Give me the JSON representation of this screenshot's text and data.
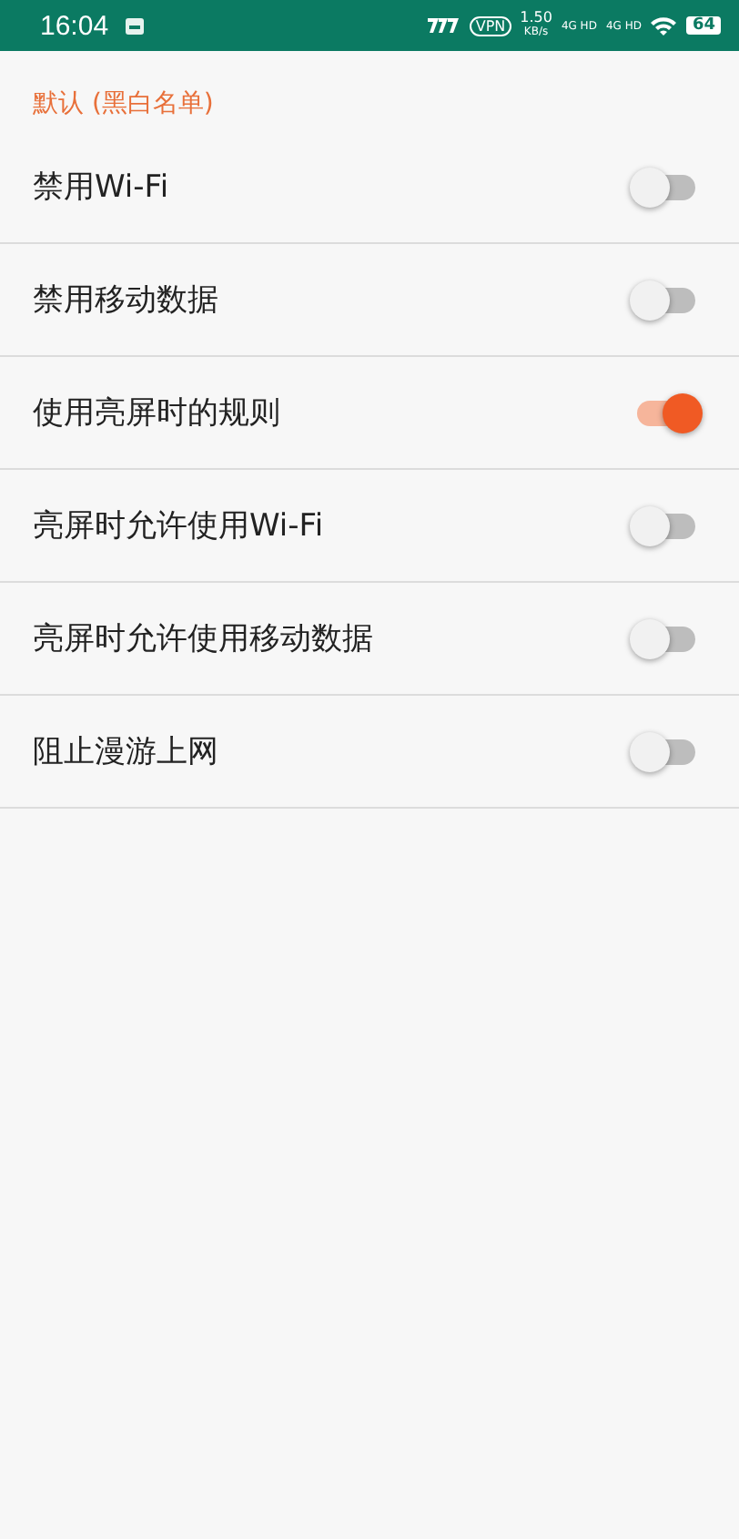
{
  "status_bar": {
    "time": "16:04",
    "vpn": "VPN",
    "speed": "1.50",
    "speed_unit": "KB/s",
    "network_1": "4G HD",
    "network_2": "4G HD",
    "battery": "64"
  },
  "section": {
    "title": "默认 (黑白名单)"
  },
  "settings": [
    {
      "label": "禁用Wi-Fi",
      "on": false
    },
    {
      "label": "禁用移动数据",
      "on": false
    },
    {
      "label": "使用亮屏时的规则",
      "on": true
    },
    {
      "label": "亮屏时允许使用Wi-Fi",
      "on": false
    },
    {
      "label": "亮屏时允许使用移动数据",
      "on": false
    },
    {
      "label": "阻止漫游上网",
      "on": false
    }
  ]
}
